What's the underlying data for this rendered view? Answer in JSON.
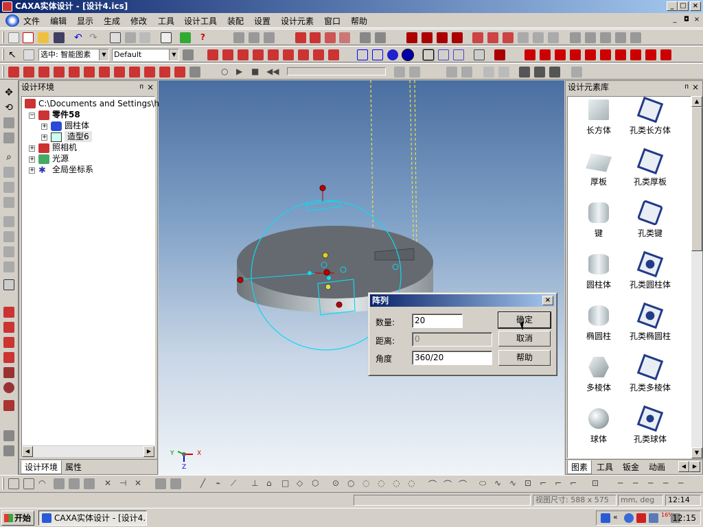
{
  "window": {
    "title": "CAXA实体设计 - [设计4.ics]",
    "min": "_",
    "max": "□",
    "close": "×"
  },
  "menu": {
    "items": [
      "文件",
      "编辑",
      "显示",
      "生成",
      "修改",
      "工具",
      "设计工具",
      "装配",
      "设置",
      "设计元素",
      "窗口",
      "帮助"
    ]
  },
  "toolbar2": {
    "select_mode": "选中: 智能图素",
    "style": "Default"
  },
  "tree_panel": {
    "title": "设计环境",
    "pin": "ᴨ",
    "close": "×",
    "items": [
      {
        "label": "C:\\Documents and Settings\\hanshu",
        "expander": "−"
      },
      {
        "label": "零件58",
        "expander": "−"
      },
      {
        "label": "圆柱体",
        "expander": "+"
      },
      {
        "label": "造型6",
        "expander": "+"
      },
      {
        "label": "照相机",
        "expander": "+"
      },
      {
        "label": "光源",
        "expander": "+"
      },
      {
        "label": "全局坐标系",
        "expander": "+"
      }
    ],
    "tabs": [
      "设计环境",
      "属性"
    ]
  },
  "library_panel": {
    "title": "设计元素库",
    "pin": "ᴨ",
    "close": "×",
    "items": [
      "长方体",
      "孔类长方体",
      "厚板",
      "孔类厚板",
      "键",
      "孔类键",
      "圆柱体",
      "孔类圆柱体",
      "椭圆柱",
      "孔类椭圆柱",
      "多棱体",
      "孔类多棱体",
      "球体",
      "孔类球体"
    ],
    "tabs": [
      "图素",
      "工具",
      "钣金",
      "动画"
    ]
  },
  "viewport": {
    "axis_y": "Y",
    "axis_x": "X",
    "axis_z": "Z"
  },
  "dialog": {
    "title": "阵列",
    "close": "×",
    "count_label": "数量:",
    "count_value": "20",
    "distance_label": "距离:",
    "distance_value": "0",
    "angle_label": "角度",
    "angle_value": "360/20",
    "ok": "确定",
    "cancel": "取消",
    "help": "帮助"
  },
  "status": {
    "view_size": "视图尺寸: 588 x 575",
    "units": "mm, deg",
    "time": "12:14"
  },
  "taskbar": {
    "start": "开始",
    "app": "CAXA实体设计 - [设计4...",
    "tray_pct": "16%",
    "clock": "12:15"
  },
  "colors": {
    "title_blue": "#0a246a",
    "face": "#d4d0c8",
    "accent_red": "#c00000",
    "cyan": "#00c8e0"
  }
}
